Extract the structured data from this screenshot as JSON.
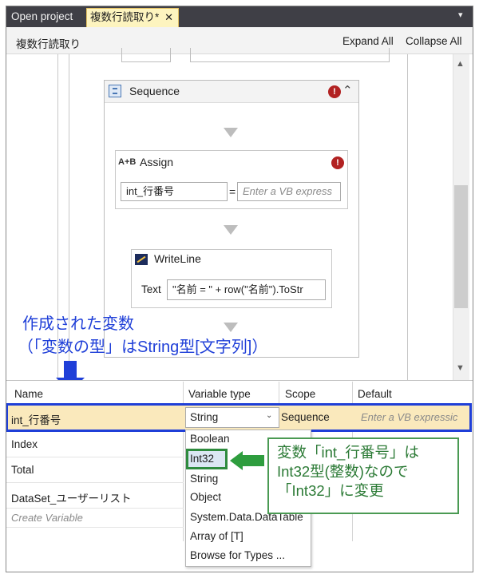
{
  "tabs": {
    "open_project": "Open project",
    "active": "複数行読取り*",
    "close_glyph": "✕",
    "menu_glyph": "▾"
  },
  "header": {
    "title": "複数行読取り",
    "expand_all": "Expand All",
    "collapse_all": "Collapse All"
  },
  "sequence": {
    "label": "Sequence",
    "error_glyph": "!",
    "collapse_glyph": "⌃"
  },
  "assign": {
    "label": "Assign",
    "icon_text": "A+B",
    "to_value": "int_行番号",
    "equals": "=",
    "value_placeholder": "Enter a VB express"
  },
  "writeline": {
    "label": "WriteLine",
    "text_label": "Text",
    "text_value": "\"名前 = \" + row(\"名前\").ToStr"
  },
  "annotation_created": {
    "line1": "作成された変数",
    "line2": "（「変数の型」はString型[文字列]）"
  },
  "variables": {
    "columns": [
      "Name",
      "Variable type",
      "Scope",
      "Default"
    ],
    "selected_row": {
      "name": "int_行番号",
      "type": "String",
      "scope": "Sequence",
      "default_placeholder": "Enter a VB expressic"
    },
    "rows": [
      "Index",
      "Total",
      "DataSet_ユーザーリスト"
    ],
    "create_variable": "Create Variable"
  },
  "type_dropdown": {
    "items": [
      "Boolean",
      "Int32",
      "String",
      "Object",
      "System.Data.DataTable",
      "Array of [T]",
      "Browse for Types ..."
    ]
  },
  "annotation_change": {
    "line1": "変数「int_行番号」は",
    "line2": "Int32型(整数)なので",
    "line3": "「Int32」に変更"
  },
  "colors": {
    "accent_blue": "#1f3fd8",
    "accent_green": "#2e8b3e",
    "selected_row": "#fae9bc",
    "error_red": "#b22222"
  }
}
